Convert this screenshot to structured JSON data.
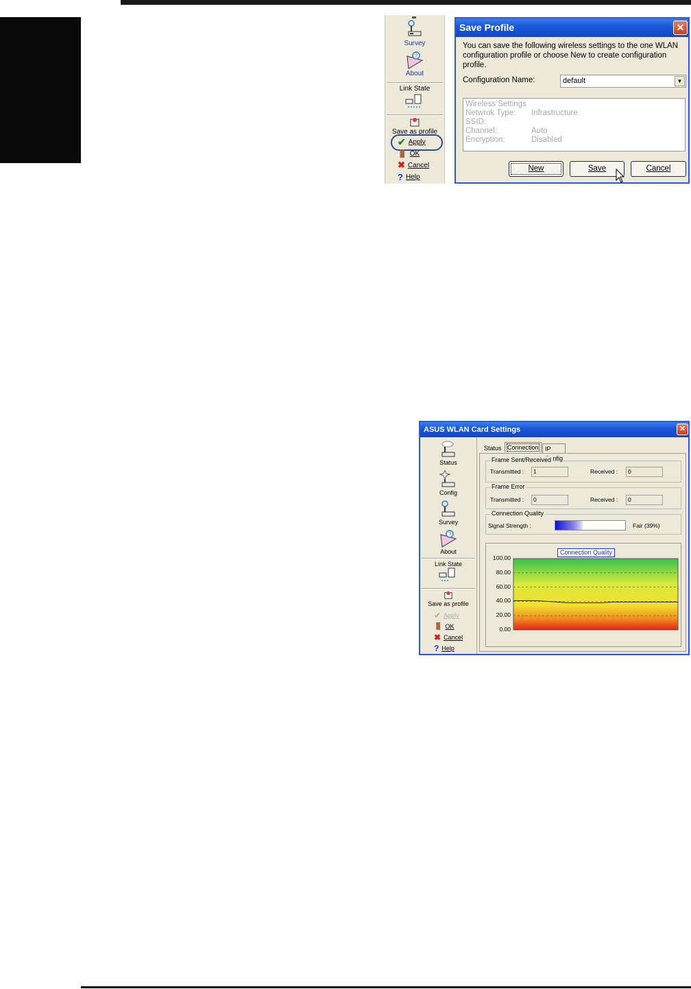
{
  "save_profile_panel": {
    "toolbar": {
      "survey_label": "Survey",
      "about_label": "About",
      "link_state_label": "Link State",
      "save_as_profile_label": "Save as profile",
      "apply_label": "Apply",
      "ok_label": "OK",
      "cancel_label": "Cancel",
      "help_label": "Help"
    },
    "dialog": {
      "title": "Save Profile",
      "close_glyph": "✕",
      "instructions": "You can save the following wireless settings to the one WLAN configuration profile or choose New to create configuration profile.",
      "config_name_label": "Configuration Name:",
      "config_name_value": "default",
      "settings": {
        "heading": "Wireless Settings",
        "rows": [
          {
            "label": "Netwrok Type:",
            "value": "Infrastructure"
          },
          {
            "label": "SSID:",
            "value": ""
          },
          {
            "label": "Channel:",
            "value": "Auto"
          },
          {
            "label": "Encryption:",
            "value": "Disabled"
          }
        ]
      },
      "buttons": {
        "new": "New",
        "save": "Save",
        "cancel": "Cancel"
      }
    }
  },
  "wlan_window": {
    "title": "ASUS WLAN Card Settings",
    "close_glyph": "✕",
    "toolbar": {
      "status_label": "Status",
      "config_label": "Config",
      "survey_label": "Survey",
      "about_label": "About",
      "link_state_label": "Link State",
      "save_as_profile_label": "Save as profile",
      "apply_label": "Apply",
      "ok_label": "OK",
      "cancel_label": "Cancel",
      "help_label": "Help"
    },
    "tabs": [
      "Status",
      "Connection",
      "IP Config"
    ],
    "selected_tab": "Connection",
    "frame_sent_received": {
      "label": "Frame Sent/Received",
      "transmitted_label": "Transmitted :",
      "transmitted_value": "1",
      "received_label": "Received :",
      "received_value": "0"
    },
    "frame_error": {
      "label": "Frame Error",
      "transmitted_label": "Transmitted :",
      "transmitted_value": "0",
      "received_label": "Received :",
      "received_value": "0"
    },
    "connection_quality": {
      "label": "Connection Quality",
      "signal_label": "Signal Strength :",
      "signal_percent": 39,
      "signal_text": "Fair (39%)"
    }
  },
  "colors": {
    "title_bar": "#1c58d8",
    "link_blue": "#1c32c8",
    "apply_ring": "#2c4aa0",
    "check_green": "#1a8a1a",
    "cancel_red": "#d81c1c"
  },
  "chart_data": {
    "type": "line",
    "title": "Connection Quality",
    "xlabel": "",
    "ylabel": "",
    "ylim": [
      0,
      100
    ],
    "y_ticks": [
      "100.00",
      "80.00",
      "60.00",
      "40.00",
      "20.00",
      "0.00"
    ],
    "grid": true,
    "background": "gradient green-yellow-red",
    "series": [
      {
        "values": [
          41,
          41,
          41,
          40,
          39,
          38,
          38,
          38,
          38,
          39,
          39,
          39,
          39,
          39,
          39,
          39
        ]
      }
    ]
  }
}
